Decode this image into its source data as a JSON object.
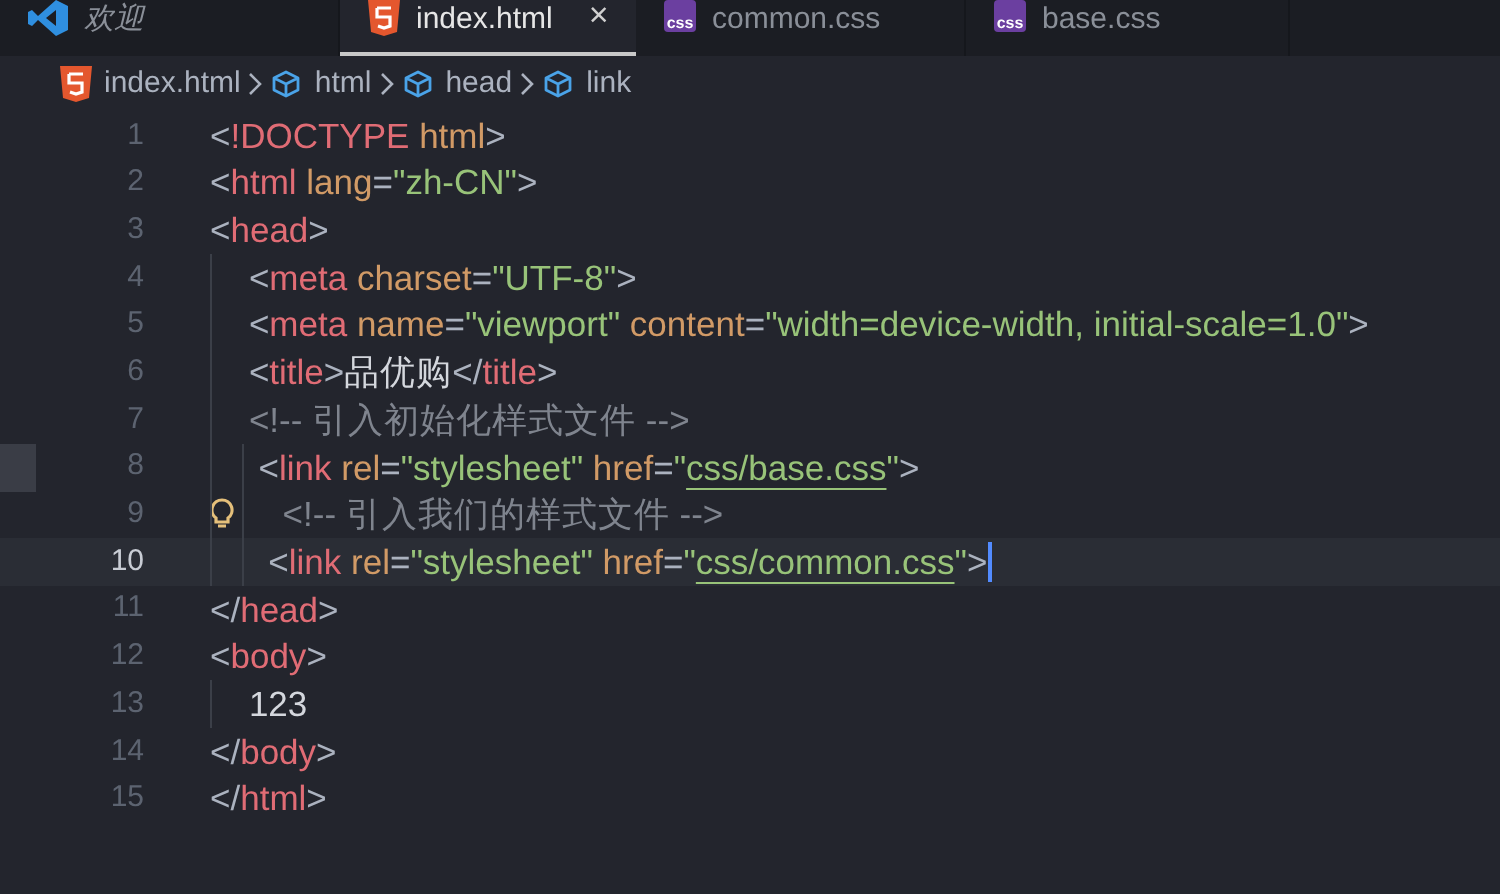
{
  "tabs": [
    {
      "label": "欢迎",
      "kind": "logo",
      "selected": false,
      "preview": true
    },
    {
      "label": "index.html",
      "kind": "html",
      "selected": true,
      "preview": false,
      "close": "×"
    },
    {
      "label": "common.css",
      "kind": "css",
      "icon_text": "css",
      "selected": false,
      "preview": false
    },
    {
      "label": "base.css",
      "kind": "css",
      "icon_text": "css",
      "selected": false,
      "preview": false
    }
  ],
  "breadcrumbs": [
    {
      "label": "index.html",
      "kind": "html"
    },
    {
      "label": "html",
      "kind": "symbol"
    },
    {
      "label": "head",
      "kind": "symbol"
    },
    {
      "label": "link",
      "kind": "symbol"
    }
  ],
  "lines": [
    {
      "number": "1",
      "current": false,
      "hint": false,
      "marker": false,
      "tokens": [
        {
          "kind": "punct",
          "text": "<"
        },
        {
          "kind": "tag",
          "text": "!DOCTYPE"
        },
        {
          "kind": "attr",
          "text": " html"
        },
        {
          "kind": "punct",
          "text": ">"
        }
      ]
    },
    {
      "number": "2",
      "current": false,
      "hint": false,
      "marker": false,
      "tokens": [
        {
          "kind": "punct",
          "text": "<"
        },
        {
          "kind": "tag",
          "text": "html"
        },
        {
          "kind": "attr",
          "text": " lang"
        },
        {
          "kind": "punct",
          "text": "="
        },
        {
          "kind": "string",
          "text": "\"zh-CN\""
        },
        {
          "kind": "punct",
          "text": ">"
        }
      ]
    },
    {
      "number": "3",
      "current": false,
      "hint": false,
      "marker": false,
      "tokens": [
        {
          "kind": "punct",
          "text": "<"
        },
        {
          "kind": "tag",
          "text": "head"
        },
        {
          "kind": "punct",
          "text": ">"
        }
      ]
    },
    {
      "number": "4",
      "current": false,
      "hint": false,
      "marker": false,
      "tokens": [
        {
          "kind": "punct",
          "text": "    <"
        },
        {
          "kind": "tag",
          "text": "meta"
        },
        {
          "kind": "attr",
          "text": " charset"
        },
        {
          "kind": "punct",
          "text": "="
        },
        {
          "kind": "string",
          "text": "\"UTF-8\""
        },
        {
          "kind": "punct",
          "text": ">"
        }
      ]
    },
    {
      "number": "5",
      "current": false,
      "hint": false,
      "marker": false,
      "tokens": [
        {
          "kind": "punct",
          "text": "    <"
        },
        {
          "kind": "tag",
          "text": "meta"
        },
        {
          "kind": "attr",
          "text": " name"
        },
        {
          "kind": "punct",
          "text": "="
        },
        {
          "kind": "string",
          "text": "\"viewport\""
        },
        {
          "kind": "attr",
          "text": " content"
        },
        {
          "kind": "punct",
          "text": "="
        },
        {
          "kind": "string",
          "text": "\"width=device-width, initial-scale=1.0\""
        },
        {
          "kind": "punct",
          "text": ">"
        }
      ]
    },
    {
      "number": "6",
      "current": false,
      "hint": false,
      "marker": false,
      "tokens": [
        {
          "kind": "punct",
          "text": "    <"
        },
        {
          "kind": "tag",
          "text": "title"
        },
        {
          "kind": "punct",
          "text": ">"
        },
        {
          "kind": "text",
          "text": "品优购"
        },
        {
          "kind": "punct",
          "text": "</"
        },
        {
          "kind": "tag",
          "text": "title"
        },
        {
          "kind": "punct",
          "text": ">"
        }
      ]
    },
    {
      "number": "7",
      "current": false,
      "hint": false,
      "marker": false,
      "tokens": [
        {
          "kind": "comment",
          "text": "    <!-- 引入初始化样式文件 -->"
        }
      ]
    },
    {
      "number": "8",
      "current": false,
      "hint": false,
      "marker": true,
      "tokens": [
        {
          "kind": "punct",
          "text": "     <"
        },
        {
          "kind": "tag",
          "text": "link"
        },
        {
          "kind": "attr",
          "text": " rel"
        },
        {
          "kind": "punct",
          "text": "="
        },
        {
          "kind": "string",
          "text": "\"stylesheet\""
        },
        {
          "kind": "attr",
          "text": " href"
        },
        {
          "kind": "punct",
          "text": "="
        },
        {
          "kind": "string",
          "text": "\""
        },
        {
          "kind": "link",
          "text": "css/base.css"
        },
        {
          "kind": "string",
          "text": "\""
        },
        {
          "kind": "punct",
          "text": ">"
        }
      ]
    },
    {
      "number": "9",
      "current": false,
      "hint": true,
      "marker": false,
      "tokens": [
        {
          "kind": "comment",
          "text": "     <!-- 引入我们的样式文件 -->"
        }
      ]
    },
    {
      "number": "10",
      "current": true,
      "hint": false,
      "marker": false,
      "tokens": [
        {
          "kind": "punct",
          "text": "      <"
        },
        {
          "kind": "tag",
          "text": "link"
        },
        {
          "kind": "attr",
          "text": " rel"
        },
        {
          "kind": "punct",
          "text": "="
        },
        {
          "kind": "string",
          "text": "\"stylesheet\""
        },
        {
          "kind": "attr",
          "text": " href"
        },
        {
          "kind": "punct",
          "text": "="
        },
        {
          "kind": "string",
          "text": "\""
        },
        {
          "kind": "link",
          "text": "css/common.css"
        },
        {
          "kind": "string",
          "text": "\""
        },
        {
          "kind": "punct",
          "text": ">"
        }
      ]
    },
    {
      "number": "11",
      "current": false,
      "hint": false,
      "marker": false,
      "tokens": [
        {
          "kind": "punct",
          "text": "</"
        },
        {
          "kind": "tag",
          "text": "head"
        },
        {
          "kind": "punct",
          "text": ">"
        }
      ]
    },
    {
      "number": "12",
      "current": false,
      "hint": false,
      "marker": false,
      "tokens": [
        {
          "kind": "punct",
          "text": "<"
        },
        {
          "kind": "tag",
          "text": "body"
        },
        {
          "kind": "punct",
          "text": ">"
        }
      ]
    },
    {
      "number": "13",
      "current": false,
      "hint": false,
      "marker": false,
      "tokens": [
        {
          "kind": "text",
          "text": "    123"
        }
      ]
    },
    {
      "number": "14",
      "current": false,
      "hint": false,
      "marker": false,
      "tokens": [
        {
          "kind": "punct",
          "text": "</"
        },
        {
          "kind": "tag",
          "text": "body"
        },
        {
          "kind": "punct",
          "text": ">"
        }
      ]
    },
    {
      "number": "15",
      "current": false,
      "hint": false,
      "marker": false,
      "tokens": [
        {
          "kind": "punct",
          "text": "</"
        },
        {
          "kind": "tag",
          "text": "html"
        },
        {
          "kind": "punct",
          "text": ">"
        }
      ]
    }
  ]
}
